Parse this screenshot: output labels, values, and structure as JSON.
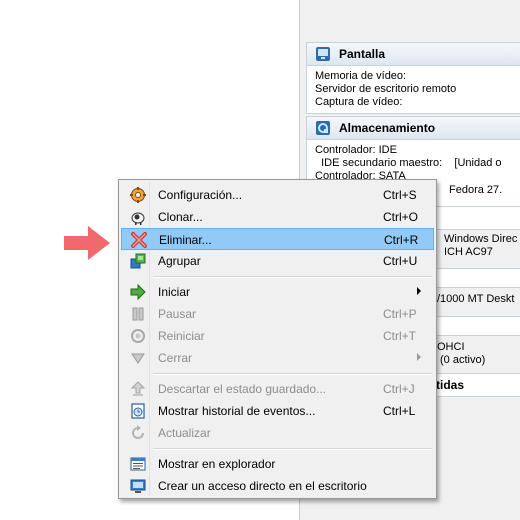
{
  "colors": {
    "accent_highlight": "#91c9f7",
    "pointer": "#f0696c",
    "disabled_text": "#8d8d8d"
  },
  "details": {
    "display": {
      "title": "Pantalla",
      "icon": "monitor-icon",
      "lines": [
        "Memoria de vídeo:",
        "Servidor de escritorio remoto",
        "Captura de vídeo:"
      ]
    },
    "storage": {
      "title": "Almacenamiento",
      "icon": "storage-icon",
      "lines": [
        "Controlador: IDE",
        "  IDE secundario maestro:    [Unidad o",
        "Controlador: SATA"
      ],
      "fragment_disk": "Fedora 27."
    },
    "audio": {
      "line1": "Windows Direc",
      "line2": "ICH AC97"
    },
    "network": {
      "line1": "/1000 MT Deskt"
    },
    "usb": {
      "line1": "OHCI",
      "line2": "(0 activo)"
    },
    "shared": {
      "title_fragment": "tidas"
    }
  },
  "context_menu": {
    "items": [
      {
        "id": "configuracion",
        "label": "Configuración...",
        "shortcut": "Ctrl+S",
        "icon": "settings-gear-icon",
        "enabled": true
      },
      {
        "id": "clonar",
        "label": "Clonar...",
        "shortcut": "Ctrl+O",
        "icon": "clone-sheep-icon",
        "enabled": true
      },
      {
        "id": "eliminar",
        "label": "Eliminar...",
        "shortcut": "Ctrl+R",
        "icon": "delete-x-icon",
        "enabled": true,
        "highlighted": true
      },
      {
        "id": "agrupar",
        "label": "Agrupar",
        "shortcut": "Ctrl+U",
        "icon": "group-icon",
        "enabled": true
      },
      {
        "id": "iniciar",
        "label": "Iniciar",
        "shortcut": "",
        "icon": "start-arrow-icon",
        "enabled": true,
        "submenu": true
      },
      {
        "id": "pausar",
        "label": "Pausar",
        "shortcut": "Ctrl+P",
        "icon": "pause-icon",
        "enabled": false
      },
      {
        "id": "reiniciar",
        "label": "Reiniciar",
        "shortcut": "Ctrl+T",
        "icon": "reset-icon",
        "enabled": false
      },
      {
        "id": "cerrar",
        "label": "Cerrar",
        "shortcut": "",
        "icon": "close-triangle-icon",
        "enabled": false,
        "submenu": true
      },
      {
        "id": "descartar",
        "label": "Descartar el estado guardado...",
        "shortcut": "Ctrl+J",
        "icon": "discard-state-icon",
        "enabled": false
      },
      {
        "id": "historial",
        "label": "Mostrar historial de eventos...",
        "shortcut": "Ctrl+L",
        "icon": "event-log-icon",
        "enabled": true
      },
      {
        "id": "actualizar",
        "label": "Actualizar",
        "shortcut": "",
        "icon": "refresh-icon",
        "enabled": false
      },
      {
        "id": "explorador",
        "label": "Mostrar en explorador",
        "shortcut": "",
        "icon": "explorer-icon",
        "enabled": true
      },
      {
        "id": "acceso",
        "label": "Crear un acceso directo en el escritorio",
        "shortcut": "",
        "icon": "shortcut-icon",
        "enabled": true
      }
    ]
  }
}
